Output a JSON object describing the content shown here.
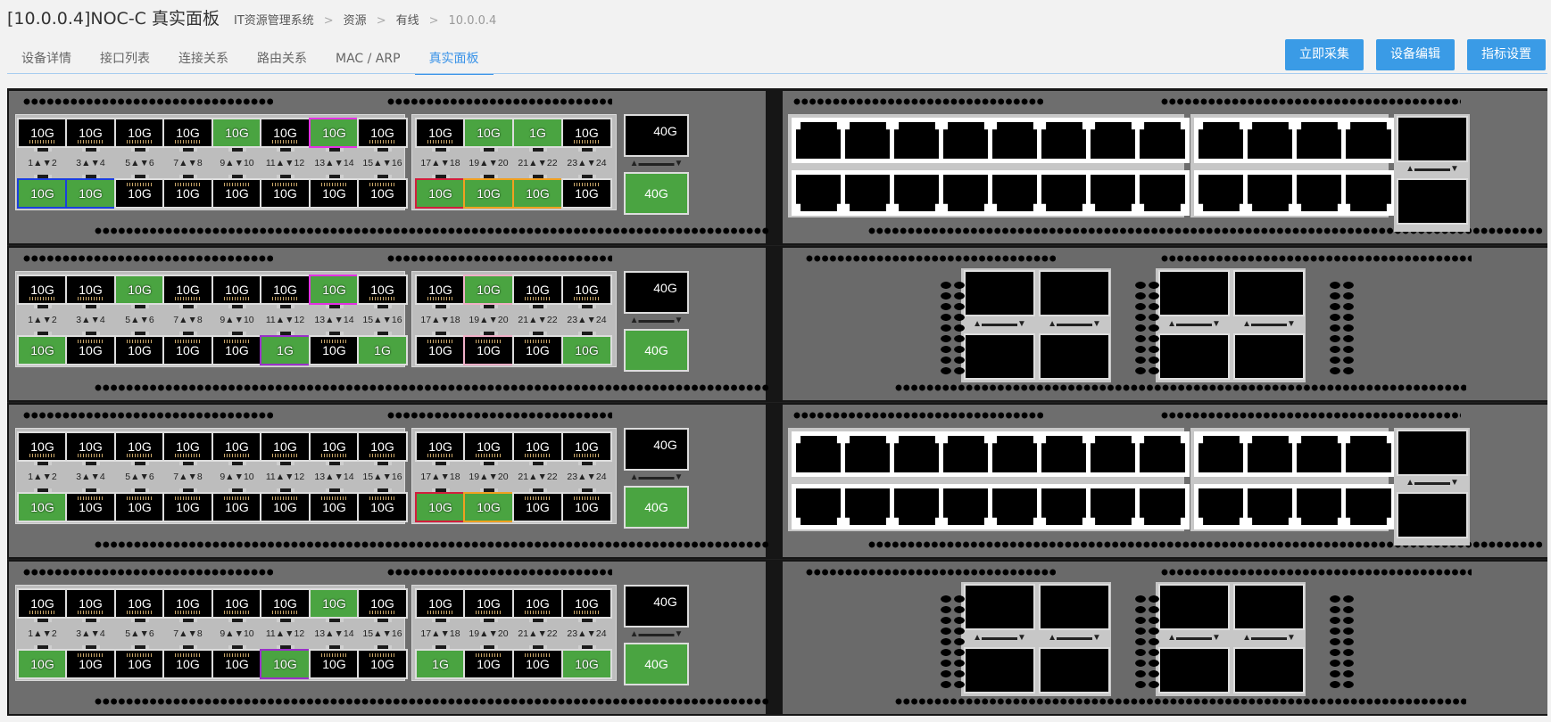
{
  "header": {
    "title": "[10.0.0.4]NOC-C 真实面板",
    "breadcrumb": [
      "IT资源管理系统",
      "资源",
      "有线",
      "10.0.0.4"
    ],
    "separator": ">"
  },
  "tabs": [
    {
      "label": "设备详情",
      "active": false
    },
    {
      "label": "接口列表",
      "active": false
    },
    {
      "label": "连接关系",
      "active": false
    },
    {
      "label": "路由关系",
      "active": false
    },
    {
      "label": "MAC / ARP",
      "active": false
    },
    {
      "label": "真实面板",
      "active": true
    }
  ],
  "actions": {
    "collect": "立即采集",
    "edit": "设备编辑",
    "metrics": "指标设置"
  },
  "colors": {
    "accent": "#3a93e8",
    "port_up": "#4aa441",
    "port_down": "#000000"
  },
  "pair_labels": [
    "1▲▼2",
    "3▲▼4",
    "5▲▼6",
    "7▲▼8",
    "9▲▼10",
    "11▲▼12",
    "13▲▼14",
    "15▲▼16",
    "17▲▼18",
    "19▲▼20",
    "21▲▼22",
    "23▲▼24"
  ],
  "uplink_label": "▲▬▬▬▬▼",
  "units": [
    {
      "right_type": "rj45",
      "top": [
        {
          "speed": "10G",
          "up": false
        },
        {
          "speed": "10G",
          "up": false
        },
        {
          "speed": "10G",
          "up": false
        },
        {
          "speed": "10G",
          "up": false
        },
        {
          "speed": "10G",
          "up": true
        },
        {
          "speed": "10G",
          "up": false
        },
        {
          "speed": "10G",
          "up": true,
          "border": "magenta"
        },
        {
          "speed": "10G",
          "up": false
        },
        {
          "speed": "10G",
          "up": false
        },
        {
          "speed": "10G",
          "up": true
        },
        {
          "speed": "1G",
          "up": true
        },
        {
          "speed": "10G",
          "up": false
        }
      ],
      "bottom": [
        {
          "speed": "10G",
          "up": true,
          "border": "blue"
        },
        {
          "speed": "10G",
          "up": true,
          "border": "blue"
        },
        {
          "speed": "10G",
          "up": false
        },
        {
          "speed": "10G",
          "up": false
        },
        {
          "speed": "10G",
          "up": false
        },
        {
          "speed": "10G",
          "up": false
        },
        {
          "speed": "10G",
          "up": false
        },
        {
          "speed": "10G",
          "up": false
        },
        {
          "speed": "10G",
          "up": true,
          "border": "red"
        },
        {
          "speed": "10G",
          "up": true,
          "border": "orange"
        },
        {
          "speed": "10G",
          "up": true,
          "border": "orange"
        },
        {
          "speed": "10G",
          "up": false
        }
      ],
      "uplinks": [
        {
          "speed": "40G",
          "up": false
        },
        {
          "speed": "40G",
          "up": true
        }
      ]
    },
    {
      "right_type": "modules",
      "top": [
        {
          "speed": "10G",
          "up": false
        },
        {
          "speed": "10G",
          "up": false
        },
        {
          "speed": "10G",
          "up": true
        },
        {
          "speed": "10G",
          "up": false
        },
        {
          "speed": "10G",
          "up": false
        },
        {
          "speed": "10G",
          "up": false
        },
        {
          "speed": "10G",
          "up": true,
          "border": "magenta"
        },
        {
          "speed": "10G",
          "up": false
        },
        {
          "speed": "10G",
          "up": false
        },
        {
          "speed": "10G",
          "up": true,
          "border": "pink"
        },
        {
          "speed": "10G",
          "up": false
        },
        {
          "speed": "10G",
          "up": false
        }
      ],
      "bottom": [
        {
          "speed": "10G",
          "up": true
        },
        {
          "speed": "10G",
          "up": false
        },
        {
          "speed": "10G",
          "up": false
        },
        {
          "speed": "10G",
          "up": false
        },
        {
          "speed": "10G",
          "up": false
        },
        {
          "speed": "1G",
          "up": true,
          "border": "purple"
        },
        {
          "speed": "10G",
          "up": false
        },
        {
          "speed": "1G",
          "up": true
        },
        {
          "speed": "10G",
          "up": false
        },
        {
          "speed": "10G",
          "up": false,
          "border": "pink"
        },
        {
          "speed": "10G",
          "up": false
        },
        {
          "speed": "10G",
          "up": true
        }
      ],
      "uplinks": [
        {
          "speed": "40G",
          "up": false
        },
        {
          "speed": "40G",
          "up": true
        }
      ]
    },
    {
      "right_type": "rj45",
      "top": [
        {
          "speed": "10G",
          "up": false
        },
        {
          "speed": "10G",
          "up": false
        },
        {
          "speed": "10G",
          "up": false
        },
        {
          "speed": "10G",
          "up": false
        },
        {
          "speed": "10G",
          "up": false
        },
        {
          "speed": "10G",
          "up": false
        },
        {
          "speed": "10G",
          "up": false
        },
        {
          "speed": "10G",
          "up": false
        },
        {
          "speed": "10G",
          "up": false
        },
        {
          "speed": "10G",
          "up": false
        },
        {
          "speed": "10G",
          "up": false
        },
        {
          "speed": "10G",
          "up": false
        }
      ],
      "bottom": [
        {
          "speed": "10G",
          "up": true
        },
        {
          "speed": "10G",
          "up": false
        },
        {
          "speed": "10G",
          "up": false
        },
        {
          "speed": "10G",
          "up": false
        },
        {
          "speed": "10G",
          "up": false
        },
        {
          "speed": "10G",
          "up": false
        },
        {
          "speed": "10G",
          "up": false
        },
        {
          "speed": "10G",
          "up": false
        },
        {
          "speed": "10G",
          "up": true,
          "border": "red"
        },
        {
          "speed": "10G",
          "up": true,
          "border": "orange"
        },
        {
          "speed": "10G",
          "up": false
        },
        {
          "speed": "10G",
          "up": false
        }
      ],
      "uplinks": [
        {
          "speed": "40G",
          "up": false
        },
        {
          "speed": "40G",
          "up": true
        }
      ]
    },
    {
      "right_type": "modules",
      "top": [
        {
          "speed": "10G",
          "up": false
        },
        {
          "speed": "10G",
          "up": false
        },
        {
          "speed": "10G",
          "up": false
        },
        {
          "speed": "10G",
          "up": false
        },
        {
          "speed": "10G",
          "up": false
        },
        {
          "speed": "10G",
          "up": false
        },
        {
          "speed": "10G",
          "up": true
        },
        {
          "speed": "10G",
          "up": false
        },
        {
          "speed": "10G",
          "up": false
        },
        {
          "speed": "10G",
          "up": false
        },
        {
          "speed": "10G",
          "up": false
        },
        {
          "speed": "10G",
          "up": false
        }
      ],
      "bottom": [
        {
          "speed": "10G",
          "up": true
        },
        {
          "speed": "10G",
          "up": false
        },
        {
          "speed": "10G",
          "up": false
        },
        {
          "speed": "10G",
          "up": false
        },
        {
          "speed": "10G",
          "up": false
        },
        {
          "speed": "10G",
          "up": true,
          "border": "purple"
        },
        {
          "speed": "10G",
          "up": false
        },
        {
          "speed": "10G",
          "up": false
        },
        {
          "speed": "1G",
          "up": true
        },
        {
          "speed": "10G",
          "up": false
        },
        {
          "speed": "10G",
          "up": false
        },
        {
          "speed": "10G",
          "up": true
        }
      ],
      "uplinks": [
        {
          "speed": "40G",
          "up": false
        },
        {
          "speed": "40G",
          "up": true
        }
      ]
    }
  ]
}
